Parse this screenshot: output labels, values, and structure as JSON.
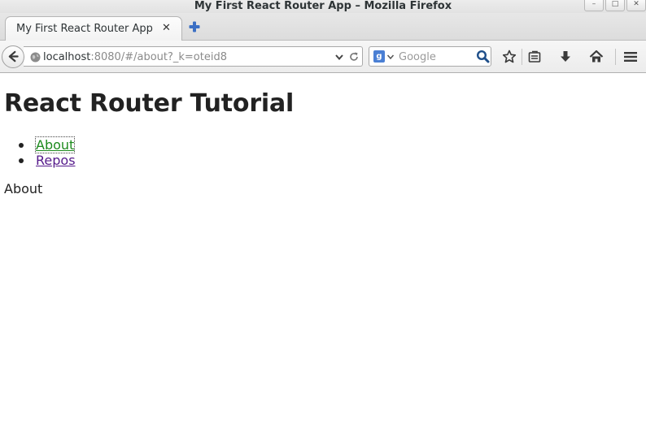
{
  "window": {
    "title": "My First React Router App – Mozilla Firefox",
    "controls": {
      "minimize": "–",
      "maximize": "□",
      "close": "✕"
    }
  },
  "tabs": [
    {
      "label": "My First React Router App",
      "close": "✕",
      "active": true
    }
  ],
  "navbar": {
    "url_host": "localhost",
    "url_rest": ":8080/#/about?_k=oteid8",
    "search": {
      "engine": "g",
      "placeholder": "Google"
    },
    "icons": [
      "back-icon",
      "globe-icon",
      "url-dropdown-icon",
      "reload-icon",
      "search-engine-icon",
      "magnifier-icon",
      "bookmark-star-icon",
      "reading-list-icon",
      "download-icon",
      "home-icon",
      "menu-icon"
    ]
  },
  "page": {
    "title": "React Router Tutorial",
    "nav_links": [
      {
        "label": "About",
        "state": "active"
      },
      {
        "label": "Repos",
        "state": "visited"
      }
    ],
    "view_text": "About"
  },
  "colors": {
    "active_link": "#1d8a1d",
    "visited_link": "#551a8b",
    "text": "#222222"
  }
}
